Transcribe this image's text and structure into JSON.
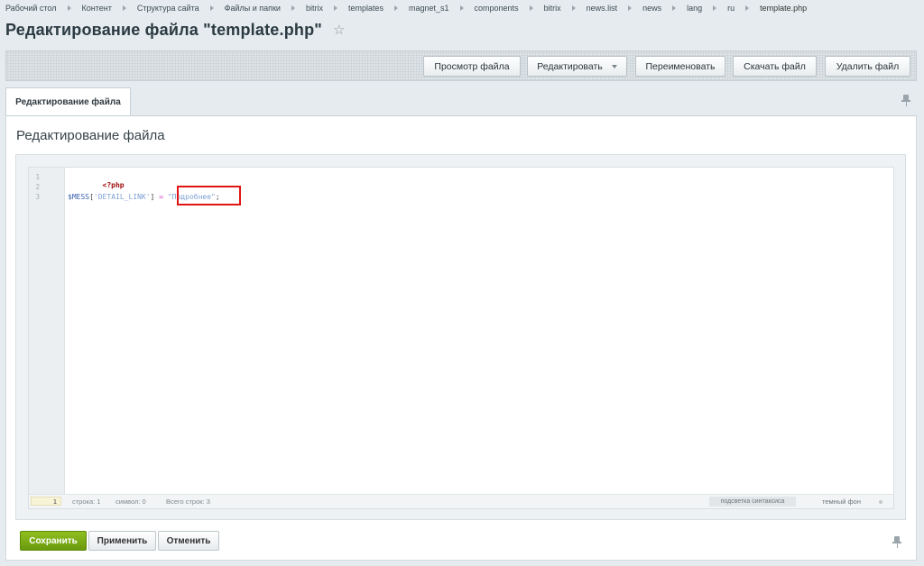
{
  "breadcrumb": [
    "Рабочий стол",
    "Контент",
    "Структура сайта",
    "Файлы и папки",
    "bitrix",
    "templates",
    "magnet_s1",
    "components",
    "bitrix",
    "news.list",
    "news",
    "lang",
    "ru",
    "template.php"
  ],
  "page": {
    "title": "Редактирование файла \"template.php\""
  },
  "toolbar": {
    "view": "Просмотр файла",
    "edit": "Редактировать",
    "rename": "Переименовать",
    "download": "Скачать файл",
    "delete": "Удалить файл"
  },
  "tabs": [
    {
      "label": "Редактирование файла",
      "active": true
    }
  ],
  "section": {
    "title": "Редактирование файла"
  },
  "editor": {
    "line_numbers": [
      "1",
      "2",
      "3"
    ],
    "code": {
      "line1": "<?php",
      "var": "$MESS",
      "open_bracket": "[",
      "key": "'DETAIL_LINK'",
      "close_bracket": "]",
      "eq": "=",
      "value": "\"Подробнее\"",
      "semicolon": ";"
    },
    "highlighted_text": "\"Подробнее\";",
    "status": {
      "current_line": "1",
      "row": "строка: 1",
      "symbol": "символ: 0",
      "total": "Всего строк: 3",
      "syntax": "подсветка синтаксиса",
      "dark": "темный фон"
    }
  },
  "buttons": {
    "save": "Сохранить",
    "apply": "Применить",
    "cancel": "Отменить"
  },
  "colors": {
    "save_button": "#7aab14",
    "highlight_border": "#e01414",
    "php_tag": "#a00f0f"
  }
}
